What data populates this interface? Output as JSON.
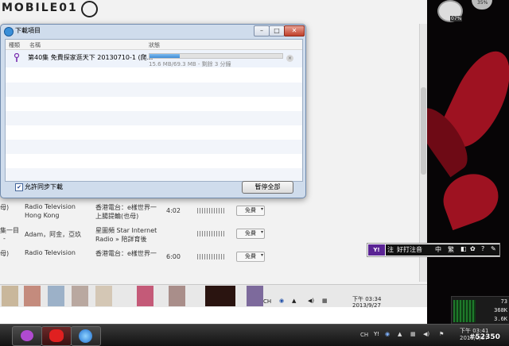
{
  "banner": {
    "logo_text": "MOBILE01"
  },
  "dialog": {
    "title": "下載項目",
    "columns": {
      "kind": "種類",
      "name": "名稱",
      "status": "狀態"
    },
    "item": {
      "title": "第40集 免費探家逛天下 20130710-1 (爬...",
      "progress_pct": 0.225,
      "progress_text": "15.6 MB/69.3 MB - 剩餘 3 分鐘"
    },
    "sync_label": "允許同步下載",
    "sync_checked": true,
    "pause_all_label": "暫停全部"
  },
  "background_list": {
    "rows": [
      {
        "c0": "母)",
        "c1": "Radio Television",
        "c1b": "Hong Kong",
        "c2": "香港電台：e樣世界一",
        "c2b": "上腸提輪(也母)",
        "c3": "4:02",
        "btn": "免費"
      },
      {
        "c0": "集一目",
        "c0b": "-",
        "c1": "Adam，阿金，亞玖",
        "c2": "星圖頻 Star Internet",
        "c2b": "Radio » 陪詳育後",
        "c3": "",
        "btn": "免費"
      },
      {
        "c0": "母)",
        "c1": "Radio Television",
        "c2": "香港電台：e樣世界一",
        "c2b": "",
        "c3": "6:00",
        "btn": "免費"
      }
    ]
  },
  "inner_tray": {
    "lang": "CH",
    "time": "下午 03:34",
    "date": "2013/9/27"
  },
  "ime": {
    "logo": "Y!",
    "mode_label": "注",
    "text": "好打注音",
    "items": [
      "中",
      "繁"
    ]
  },
  "cpu_gadget": {
    "cpu": "07%",
    "mem": "35%"
  },
  "net_gadget": {
    "values": [
      "73",
      "368K",
      "3.6K"
    ]
  },
  "taskbar": {
    "lang": "CH",
    "time": "下午 03:41",
    "date": "2013/9/27"
  },
  "watermark": "#52350",
  "colors": {
    "progress": "#3e8bd5",
    "ime_logo": "#5a2394",
    "accent_red": "#9e1221"
  },
  "icons": [
    "app-icon",
    "minimize-icon",
    "maximize-icon",
    "close-icon",
    "podcast-icon",
    "cancel-icon",
    "checkbox-icon",
    "dropdown-icon",
    "itunes-icon",
    "ime-logo-icon"
  ]
}
